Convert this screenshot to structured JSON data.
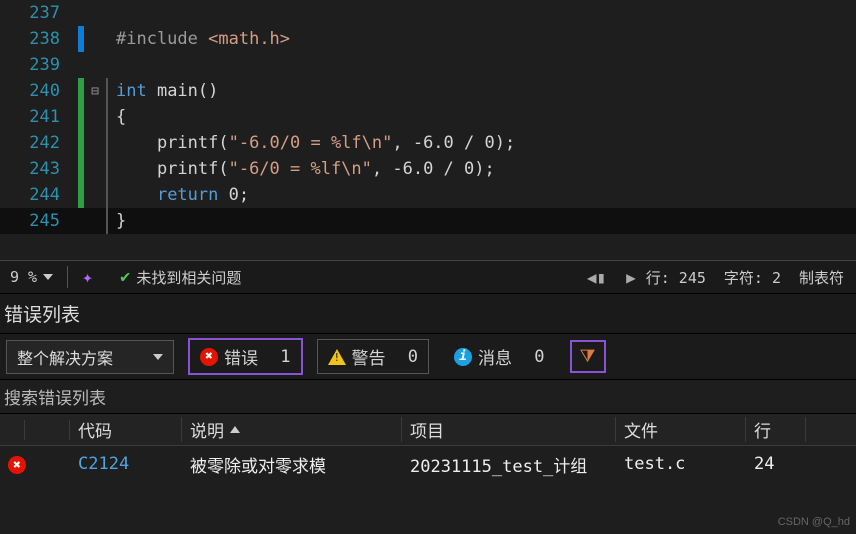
{
  "editor": {
    "lines": [
      {
        "n": 237,
        "cls": "",
        "fold": "",
        "html": ""
      },
      {
        "n": 238,
        "cls": "mod-blue",
        "fold": "",
        "html": "<span class='pp'>#include</span> <span class='str'>&lt;math.h&gt;</span>"
      },
      {
        "n": 239,
        "cls": "",
        "fold": "",
        "html": ""
      },
      {
        "n": 240,
        "cls": "mod-green",
        "fold": "⊟",
        "html": "<span class='kw'>int</span> main()"
      },
      {
        "n": 241,
        "cls": "mod-green",
        "fold": "",
        "html": "{"
      },
      {
        "n": 242,
        "cls": "mod-green",
        "fold": "",
        "html": "    printf(<span class='str'>\"-6.0/0 = %lf\\n\"</span>, -6.0 / 0);"
      },
      {
        "n": 243,
        "cls": "mod-green",
        "fold": "",
        "html": "    printf(<span class='str'>\"-6/0 = %lf\\n\"</span>, -6.0 / 0);"
      },
      {
        "n": 244,
        "cls": "mod-green",
        "fold": "",
        "html": "    <span class='kw'>return</span> 0;"
      },
      {
        "n": 245,
        "cls": "",
        "fold": "",
        "html": "}",
        "hl": true
      }
    ]
  },
  "status": {
    "zoom": "9 %",
    "issues": "未找到相关问题",
    "line": "行: 245",
    "col": "字符: 2",
    "tab": "制表符"
  },
  "errorlist": {
    "title": "错误列表",
    "scope": "整个解决方案",
    "err_label": "错误",
    "err_count": "1",
    "warn_label": "警告",
    "warn_count": "0",
    "info_label": "消息",
    "info_count": "0",
    "search_placeholder": "搜索错误列表",
    "columns": {
      "code": "代码",
      "desc": "说明",
      "proj": "项目",
      "file": "文件",
      "line": "行"
    },
    "rows": [
      {
        "code": "C2124",
        "desc": "被零除或对零求模",
        "proj": "20231115_test_计组",
        "file": "test.c",
        "line": "24"
      }
    ]
  },
  "watermark": "CSDN @Q_hd"
}
